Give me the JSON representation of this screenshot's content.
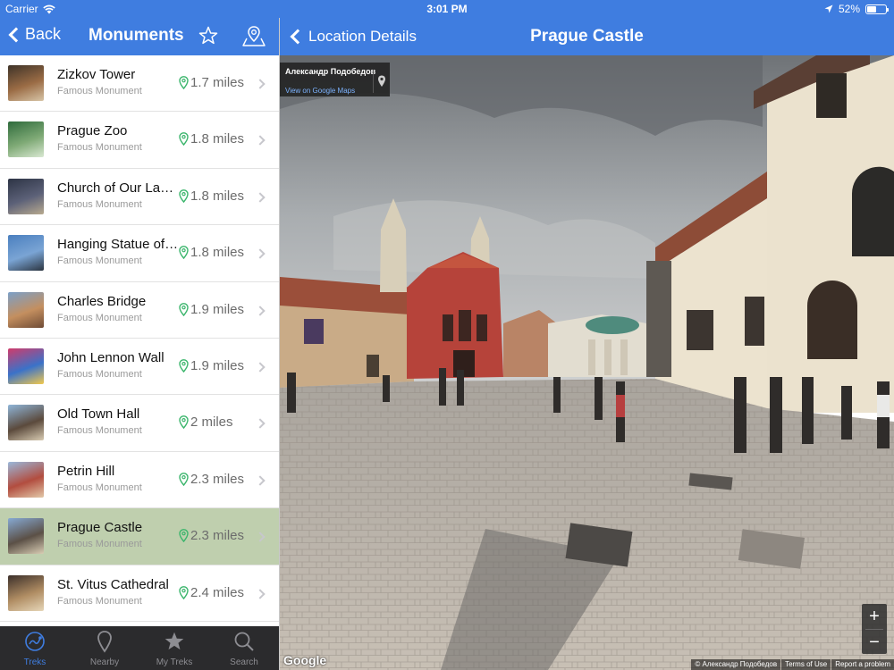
{
  "status_bar": {
    "carrier": "Carrier",
    "time": "3:01 PM",
    "battery": "52%",
    "battery_fraction": 0.52
  },
  "left_nav": {
    "back_label": "Back",
    "title": "Monuments"
  },
  "right_nav": {
    "back_label": "Location Details",
    "title": "Prague Castle"
  },
  "list": {
    "items": [
      {
        "title": "Zizkov Tower",
        "subtitle": "Famous Monument",
        "distance": "1.7 miles",
        "thumb": "zizkov-tower-thumb"
      },
      {
        "title": "Prague Zoo",
        "subtitle": "Famous Monument",
        "distance": "1.8 miles",
        "thumb": "prague-zoo-thumb"
      },
      {
        "title": "Church of Our Lady before Týn",
        "subtitle": "Famous Monument",
        "distance": "1.8 miles",
        "thumb": "church-thumb"
      },
      {
        "title": "Hanging Statue of Sigmund Freud",
        "subtitle": "Famous Monument",
        "distance": "1.8 miles",
        "thumb": "hanging-statue-thumb"
      },
      {
        "title": "Charles Bridge",
        "subtitle": "Famous Monument",
        "distance": "1.9 miles",
        "thumb": "charles-bridge-thumb"
      },
      {
        "title": "John Lennon Wall",
        "subtitle": "Famous Monument",
        "distance": "1.9 miles",
        "thumb": "lennon-wall-thumb"
      },
      {
        "title": "Old Town Hall",
        "subtitle": "Famous Monument",
        "distance": "2 miles",
        "thumb": "old-town-hall-thumb"
      },
      {
        "title": "Petrin Hill",
        "subtitle": "Famous Monument",
        "distance": "2.3 miles",
        "thumb": "petrin-hill-thumb"
      },
      {
        "title": "Prague Castle",
        "subtitle": "Famous Monument",
        "distance": "2.3 miles",
        "thumb": "prague-castle-thumb",
        "selected": true
      },
      {
        "title": "St. Vitus Cathedral",
        "subtitle": "Famous Monument",
        "distance": "2.4 miles",
        "thumb": "st-vitus-thumb"
      }
    ]
  },
  "tab_bar": {
    "tabs": [
      {
        "label": "Treks",
        "icon": "treks-icon",
        "active": true
      },
      {
        "label": "Nearby",
        "icon": "nearby-pin-icon",
        "active": false
      },
      {
        "label": "My Treks",
        "icon": "star-icon",
        "active": false
      },
      {
        "label": "Search",
        "icon": "search-icon",
        "active": false
      }
    ]
  },
  "street_view": {
    "author": "Александр Подобедов",
    "view_link": "View on Google Maps",
    "logo": "Google",
    "footer": [
      "© Александр Подобедов",
      "Terms of Use",
      "Report a problem"
    ],
    "zoom_in": "+",
    "zoom_out": "−"
  },
  "colors": {
    "accent": "#3f7de0",
    "selected_row": "#bfcfae",
    "tab_bar": "#2b2b2d",
    "pin_green": "#3ab56b"
  }
}
